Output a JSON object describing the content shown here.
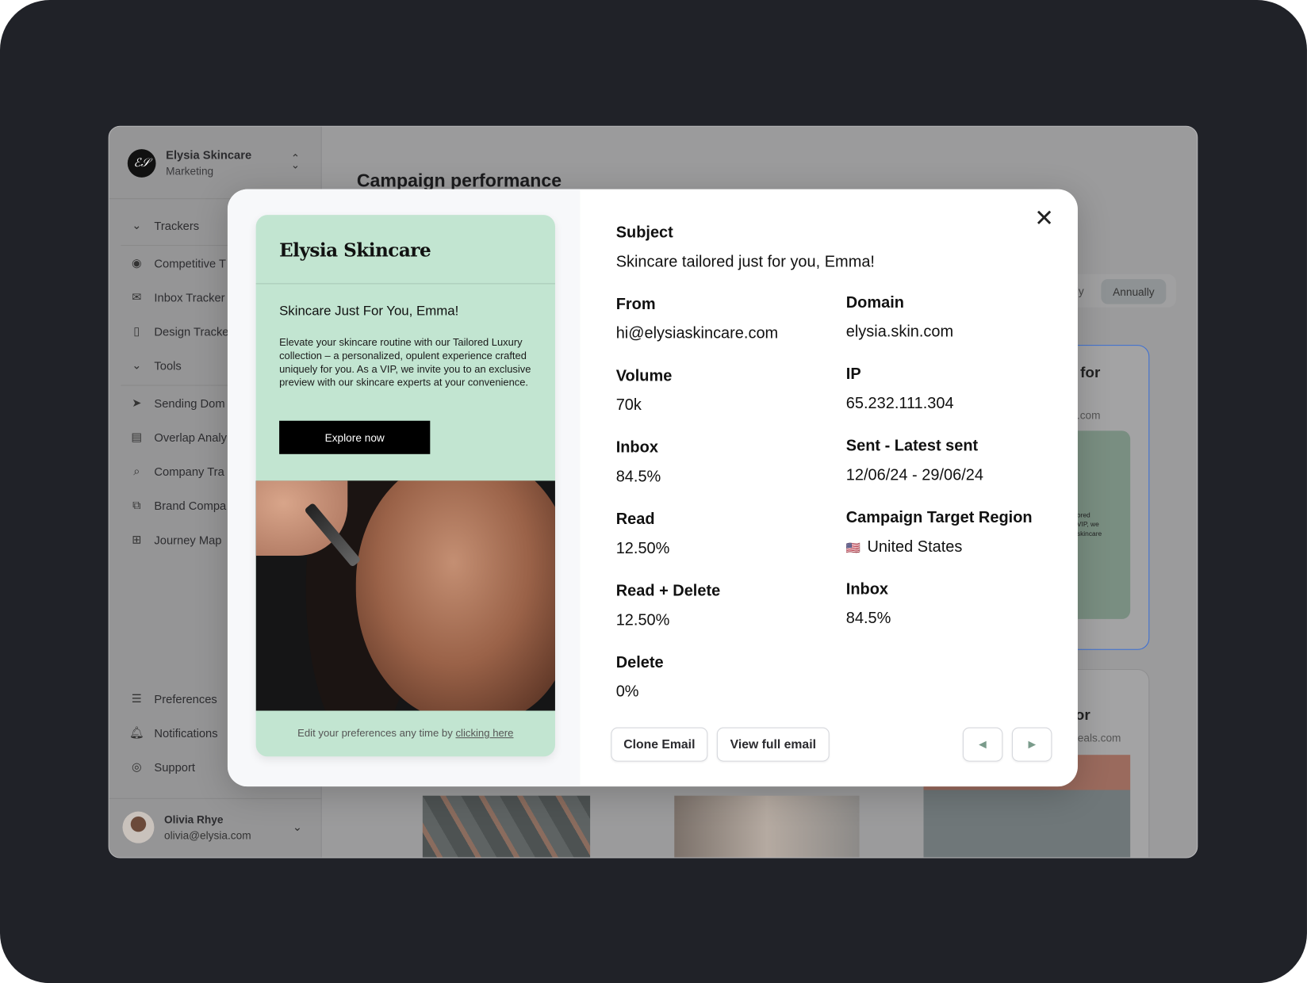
{
  "sidebar": {
    "org_name": "Elysia Skincare",
    "org_sub": "Marketing",
    "logo": "ES",
    "sections": [
      {
        "label": "Trackers"
      },
      {
        "label": "Tools"
      }
    ],
    "items": [
      {
        "label": "Competitive T",
        "icon": "eye-icon"
      },
      {
        "label": "Inbox Tracker",
        "icon": "mail-icon"
      },
      {
        "label": "Design Tracke",
        "icon": "brush-icon"
      },
      {
        "label": "Sending Dom",
        "icon": "send-icon"
      },
      {
        "label": "Overlap Analy",
        "icon": "file-search-icon"
      },
      {
        "label": "Company Tra",
        "icon": "search-icon"
      },
      {
        "label": "Brand Compa",
        "icon": "copy-icon"
      },
      {
        "label": "Journey Map",
        "icon": "flow-icon"
      }
    ],
    "footer_items": [
      {
        "label": "Preferences",
        "icon": "toggles-icon"
      },
      {
        "label": "Notifications",
        "icon": "bell-icon"
      },
      {
        "label": "Support",
        "icon": "lifebuoy-icon"
      }
    ],
    "user": {
      "name": "Olivia Rhye",
      "email": "olivia@elysia.com"
    }
  },
  "main": {
    "title": "Campaign performance",
    "period_tabs": [
      "ly",
      "Annually"
    ],
    "bg_card1": {
      "title": "for",
      "domain": ".com",
      "snippet": "ored\nVIP, we\nskincare"
    },
    "bg_card2": {
      "title": "or",
      "domain": "meals.com"
    }
  },
  "modal": {
    "email": {
      "brand": "Elysia Skincare",
      "headline": "Skincare Just For You, Emma!",
      "body": "Elevate your skincare routine with our Tailored Luxury collection – a personalized, opulent experience crafted uniquely for you. As a VIP, we invite you to an exclusive preview with our skincare experts at your convenience.",
      "cta": "Explore now",
      "footer_text": "Edit your preferences any time by ",
      "footer_link": "clicking here"
    },
    "subject_label": "Subject",
    "subject": "Skincare tailored just for you, Emma!",
    "left_fields": [
      {
        "label": "From",
        "value": "hi@elysiaskincare.com"
      },
      {
        "label": "Volume",
        "value": "70k"
      },
      {
        "label": "Inbox",
        "value": "84.5%"
      },
      {
        "label": "Read",
        "value": "12.50%"
      },
      {
        "label": "Read + Delete",
        "value": "12.50%"
      },
      {
        "label": "Delete",
        "value": "0%"
      }
    ],
    "right_fields": [
      {
        "label": "Domain",
        "value": "elysia.skin.com"
      },
      {
        "label": "IP",
        "value": "65.232.111.304"
      },
      {
        "label": "Sent - Latest sent",
        "value": "12/06/24 - 29/06/24"
      },
      {
        "label": "Campaign Target Region",
        "value": "United States",
        "flag": "🇺🇸"
      },
      {
        "label": "Inbox",
        "value": "84.5%"
      }
    ],
    "buttons": {
      "clone": "Clone Email",
      "view": "View full email",
      "prev": "◀",
      "next": "▶",
      "close": "✕"
    }
  },
  "colors": {
    "email_bg": "#c2e5d1",
    "backdrop": "#202228",
    "accent_border": "#3b6fd4"
  }
}
